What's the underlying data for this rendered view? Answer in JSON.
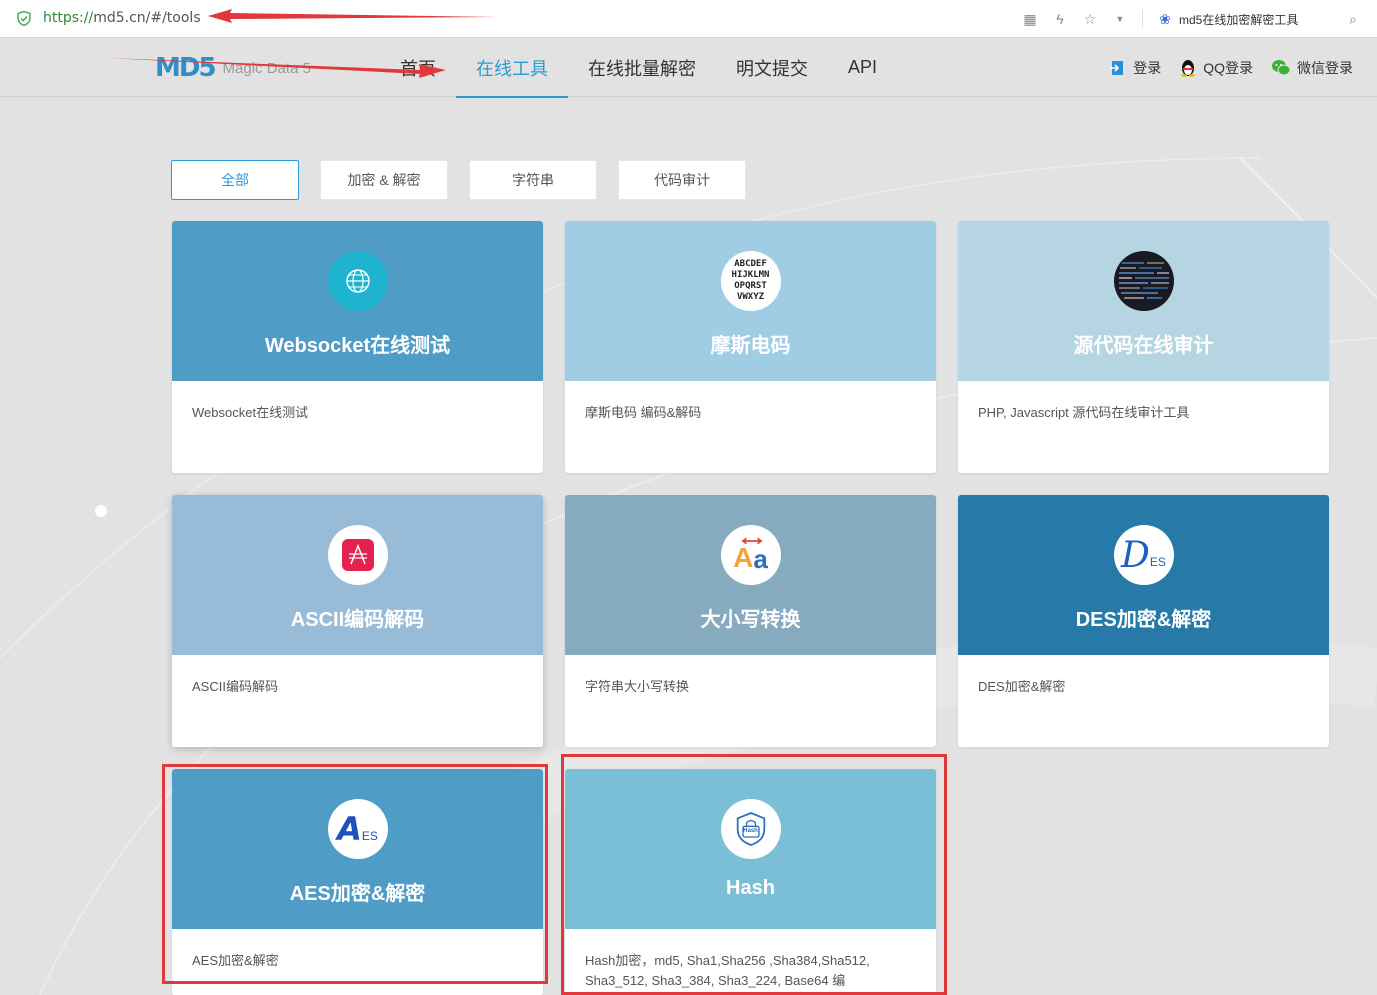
{
  "browser": {
    "url_scheme": "https://",
    "url_rest": "md5.cn/#/tools",
    "search_text": "md5在线加密解密工具"
  },
  "site": {
    "logo_mark": "MD5",
    "logo_name": "Magic Data 5",
    "nav": [
      {
        "label": "首页",
        "active": false
      },
      {
        "label": "在线工具",
        "active": true
      },
      {
        "label": "在线批量解密",
        "active": false
      },
      {
        "label": "明文提交",
        "active": false
      },
      {
        "label": "API",
        "active": false
      }
    ],
    "auth": {
      "login": "登录",
      "qq_login": "QQ登录",
      "wechat_login": "微信登录"
    }
  },
  "filters": [
    {
      "label": "全部",
      "active": true
    },
    {
      "label": "加密 & 解密",
      "active": false
    },
    {
      "label": "字符串",
      "active": false
    },
    {
      "label": "代码审计",
      "active": false
    }
  ],
  "cards": [
    {
      "title": "Websocket在线测试",
      "desc": "Websocket在线测试",
      "color": "#4f9cc6",
      "icon": "globe-icon"
    },
    {
      "title": "摩斯电码",
      "desc": "摩斯电码 编码&解码",
      "color": "#a1cde4",
      "icon": "morse-letters-icon"
    },
    {
      "title": "源代码在线审计",
      "desc": "PHP, Javascript 源代码在线审计工具",
      "color": "#b5d5e3",
      "icon": "source-code-icon"
    },
    {
      "title": "ASCII编码解码",
      "desc": "ASCII编码解码",
      "color": "#98bcd7",
      "icon": "ascii-icon"
    },
    {
      "title": "大小写转换",
      "desc": "字符串大小写转换",
      "color": "#86aabe",
      "icon": "case-convert-icon"
    },
    {
      "title": "DES加密&解密",
      "desc": "DES加密&解密",
      "color": "#2779a8",
      "icon": "des-icon"
    },
    {
      "title": "AES加密&解密",
      "desc": "AES加密&解密",
      "color": "#4f9cc6",
      "icon": "aes-icon"
    },
    {
      "title": "Hash",
      "desc": "Hash加密，md5, Sha1,Sha256 ,Sha384,Sha512, Sha3_512, Sha3_384, Sha3_224, Base64 编",
      "color": "#7bbfd7",
      "icon": "hash-shield-icon"
    }
  ],
  "icon_text": {
    "morse": "ABCDEF\nHIJKLMN\nOPQRST\nVWXYZ",
    "des_big": "D",
    "des_small": "ES",
    "aes_big": "A",
    "aes_small": "ES",
    "hash_label": "Hash",
    "case_big": "A",
    "case_small": "a"
  }
}
